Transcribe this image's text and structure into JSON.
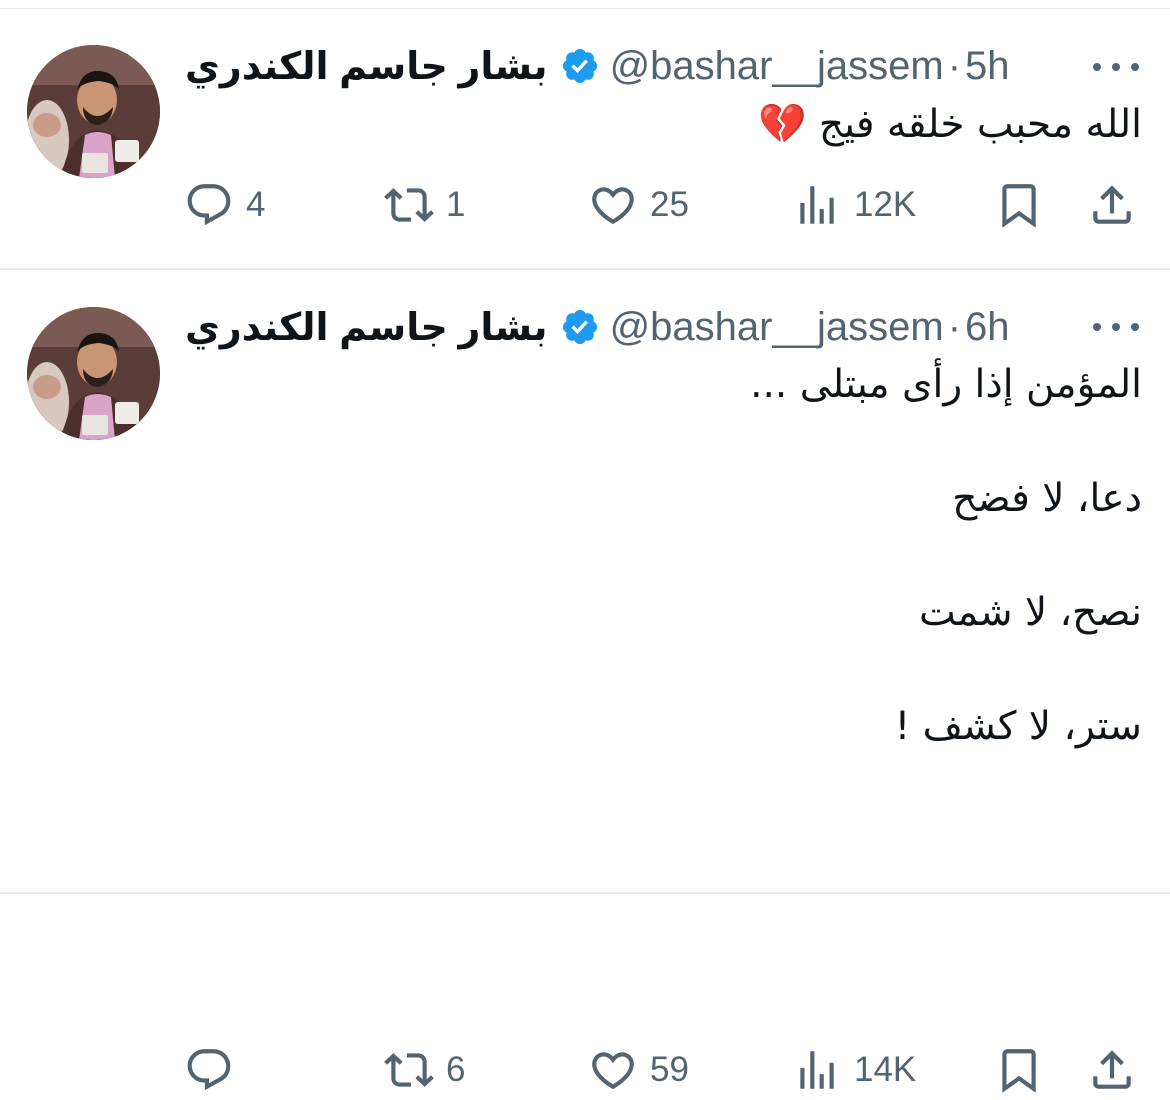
{
  "tweets": [
    {
      "display_name": "بشار جاسم الكندري",
      "handle": "@bashar__jassem",
      "separator": "·",
      "time": "5h",
      "body_lines": [
        "الله محبب خلقه فيج 💔"
      ],
      "replies": "4",
      "retweets": "1",
      "likes": "25",
      "views": "12K"
    },
    {
      "display_name": "بشار جاسم الكندري",
      "handle": "@bashar__jassem",
      "separator": "·",
      "time": "6h",
      "body_lines": [
        "المؤمن إذا رأى مبتلى ...",
        "دعا، لا فضح",
        "نصح، لا شمت",
        "ستر، لا كشف !"
      ],
      "replies": "",
      "retweets": "6",
      "likes": "59",
      "views": "14K"
    }
  ],
  "icons": {
    "reply": "reply-icon",
    "retweet": "retweet-icon",
    "like": "heart-icon",
    "views": "views-chart-icon",
    "bookmark": "bookmark-icon",
    "share": "share-icon",
    "verified": "verified-badge-icon",
    "more": "more-options-icon"
  },
  "colors": {
    "text_primary": "#0f1419",
    "text_secondary": "#536471",
    "verified_blue": "#1d9bf0",
    "divider": "#e6e9ec"
  }
}
